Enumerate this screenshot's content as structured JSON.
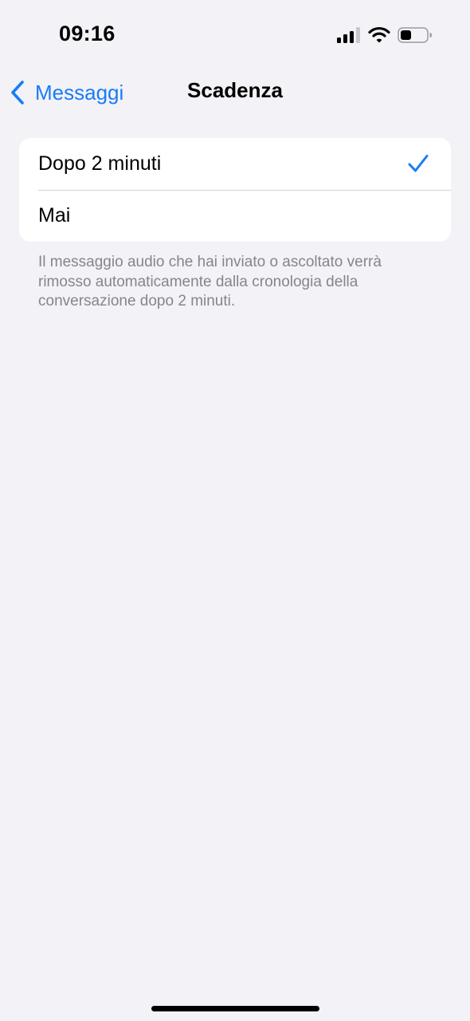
{
  "status_bar": {
    "time": "09:16",
    "signal_icon": "cellular-signal-icon",
    "wifi_icon": "wifi-icon",
    "battery_icon": "battery-icon"
  },
  "nav": {
    "back_label": "Messaggi",
    "back_icon": "chevron-left-icon",
    "title": "Scadenza"
  },
  "options": [
    {
      "label": "Dopo 2 minuti",
      "selected": true
    },
    {
      "label": "Mai",
      "selected": false
    }
  ],
  "footer_note": "Il messaggio audio che hai inviato o ascoltato verrà rimosso automaticamente dalla cronologia della conversazione dopo 2 minuti.",
  "colors": {
    "accent": "#1a7cf5",
    "background": "#f2f2f7",
    "secondary_text": "#85858b"
  }
}
